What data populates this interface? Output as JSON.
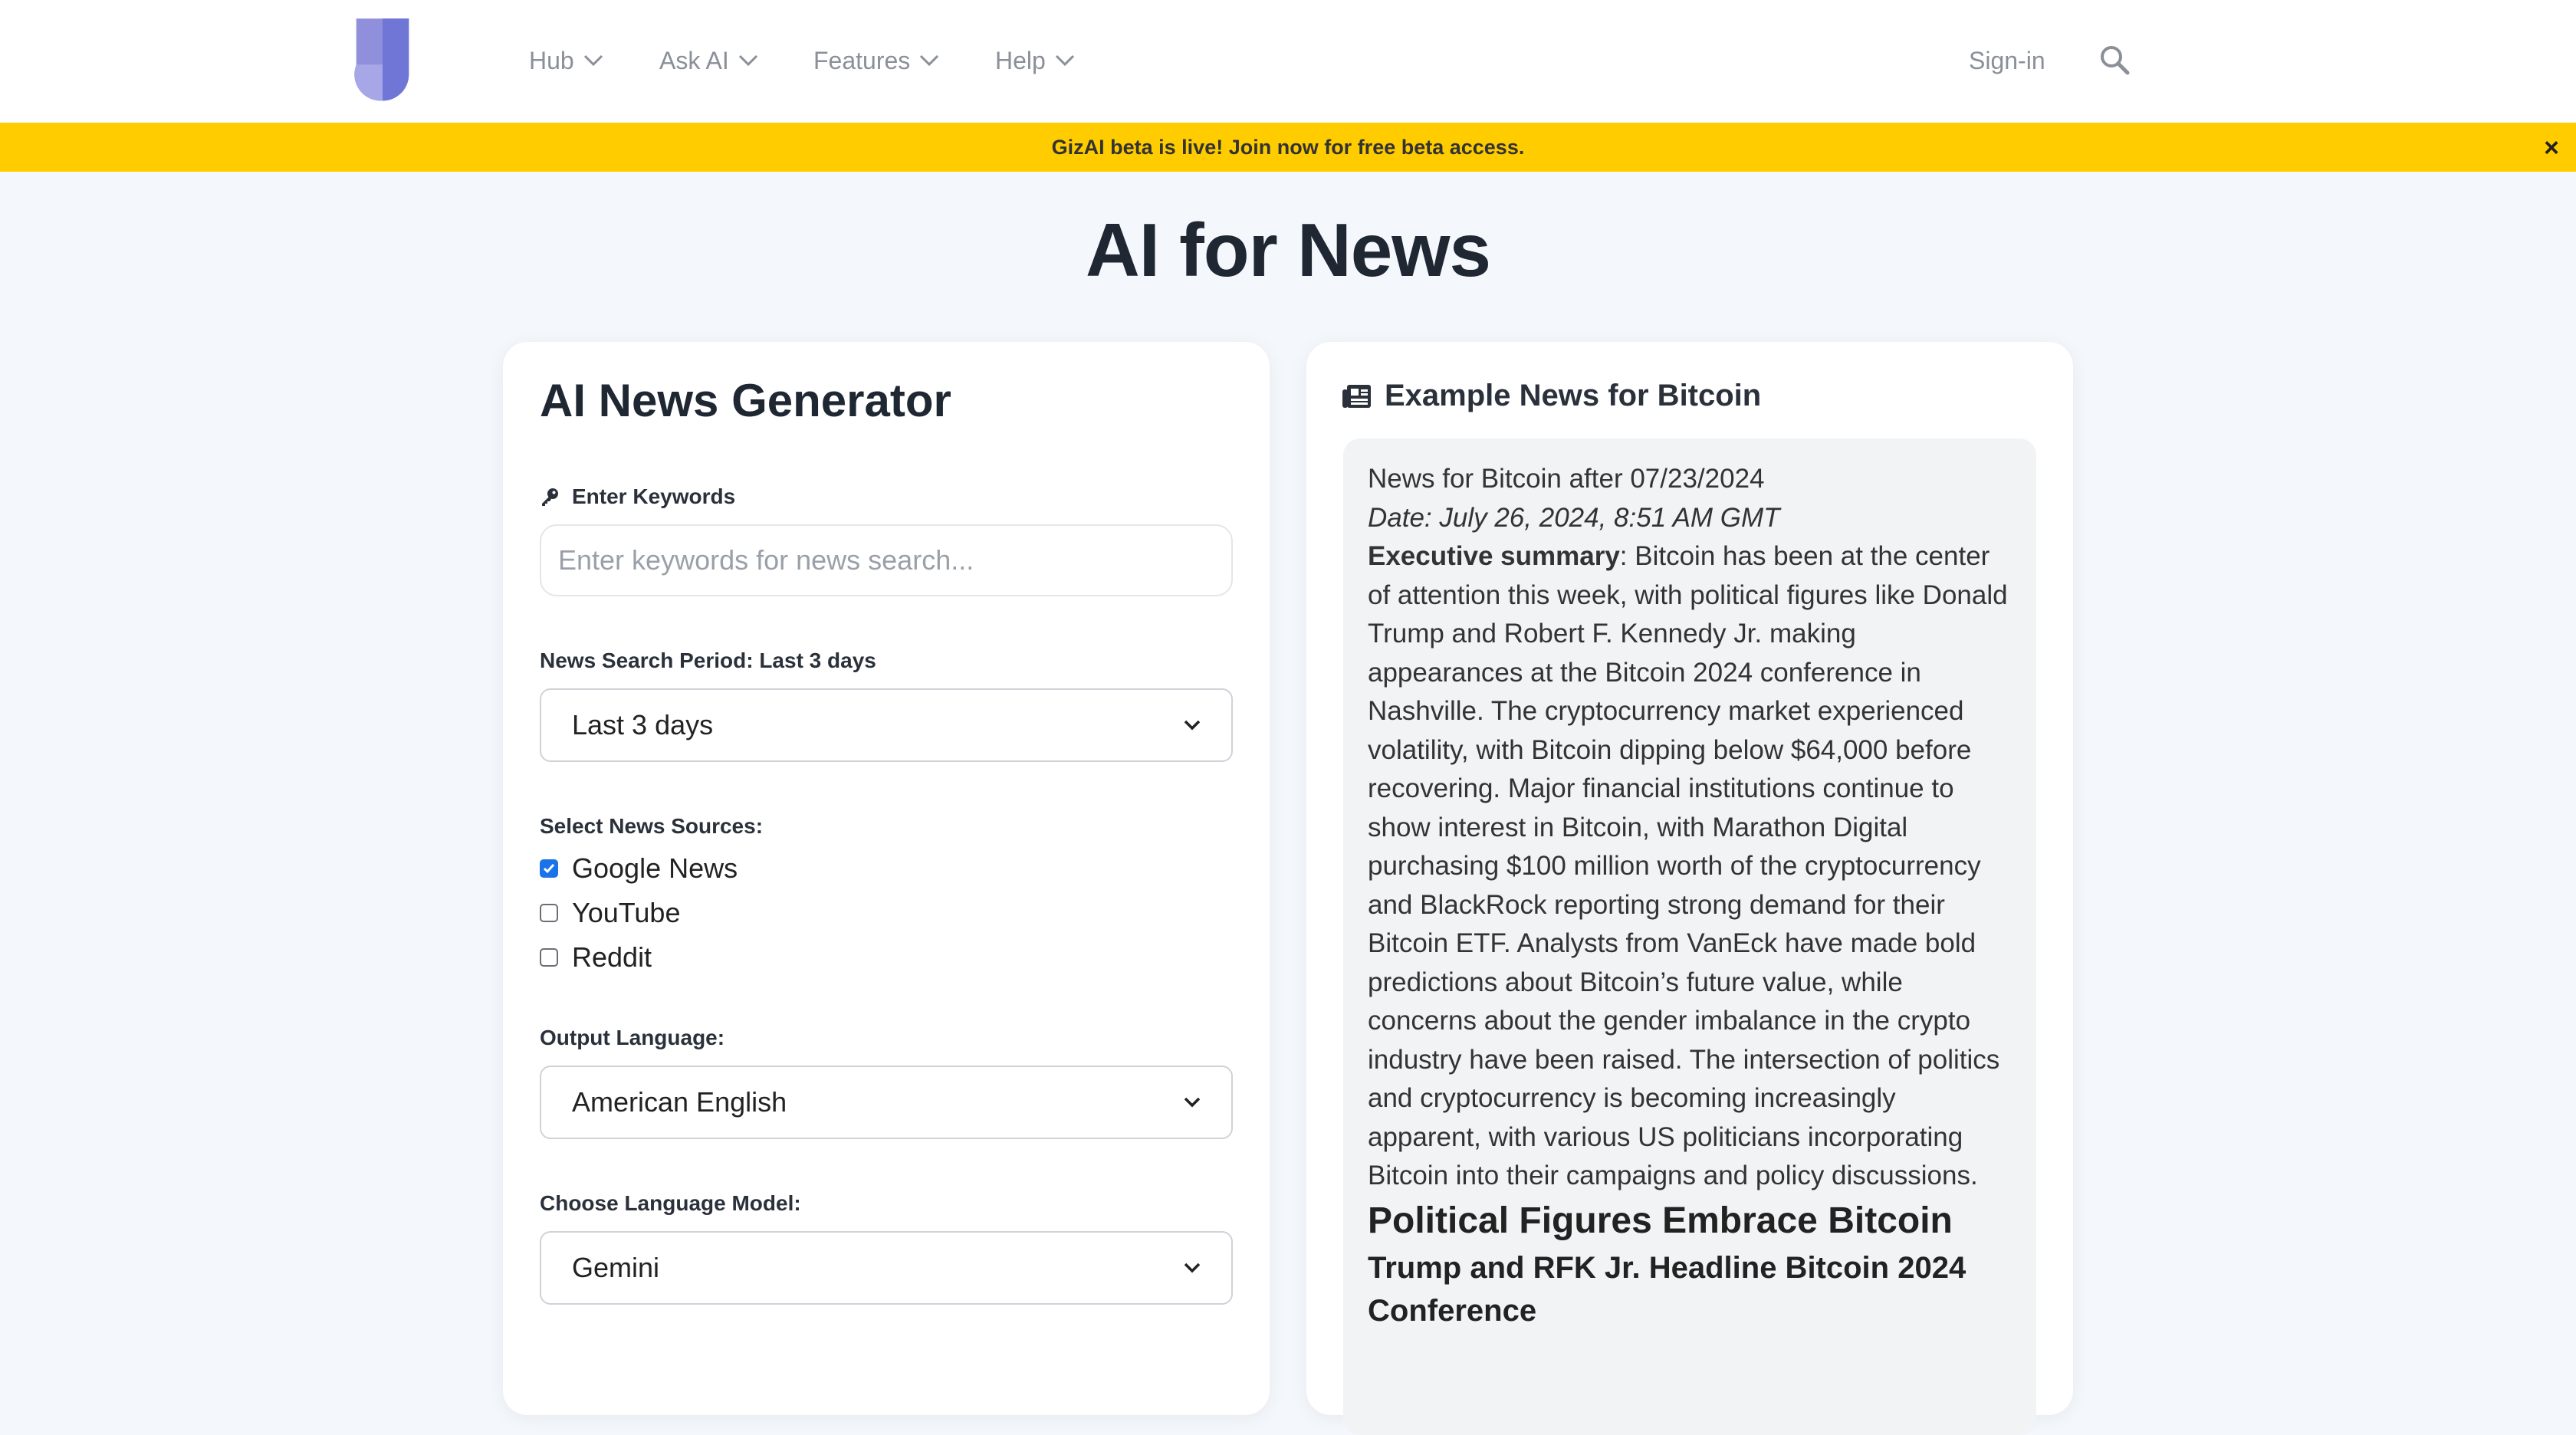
{
  "nav": {
    "items": [
      {
        "label": "Hub"
      },
      {
        "label": "Ask AI"
      },
      {
        "label": "Features"
      },
      {
        "label": "Help"
      }
    ],
    "signin_label": "Sign-in"
  },
  "banner": {
    "text": "GizAI beta is live! Join now for free beta access.",
    "close_label": "×"
  },
  "page": {
    "title": "AI for News"
  },
  "generator": {
    "title": "AI News Generator",
    "keywords_label": "Enter Keywords",
    "keywords_placeholder": "Enter keywords for news search...",
    "period_label": "News Search Period: Last 3 days",
    "period_value": "Last 3 days",
    "sources_label": "Select News Sources:",
    "sources": [
      {
        "label": "Google News",
        "checked": true
      },
      {
        "label": "YouTube",
        "checked": false
      },
      {
        "label": "Reddit",
        "checked": false
      }
    ],
    "language_label": "Output Language:",
    "language_value": "American English",
    "model_label": "Choose Language Model:",
    "model_value": "Gemini"
  },
  "example": {
    "title": "Example News for Bitcoin",
    "heading": "News for Bitcoin after 07/23/2024",
    "date": "Date: July 26, 2024, 8:51 AM GMT",
    "summary_label": "Executive summary",
    "summary_text": ": Bitcoin has been at the center of attention this week, with political figures like Donald Trump and Robert F. Kennedy Jr. making appearances at the Bitcoin 2024 conference in Nashville. The cryptocurrency market experienced volatility, with Bitcoin dipping below $64,000 before recovering. Major financial institutions continue to show interest in Bitcoin, with Marathon Digital purchasing $100 million worth of the cryptocurrency and BlackRock reporting strong demand for their Bitcoin ETF. Analysts from VanEck have made bold predictions about Bitcoin’s future value, while concerns about the gender imbalance in the crypto industry have been raised. The intersection of politics and cryptocurrency is becoming increasingly apparent, with various US politicians incorporating Bitcoin into their campaigns and policy discussions.",
    "section_title": "Political Figures Embrace Bitcoin",
    "subsection_title": "Trump and RFK Jr. Headline Bitcoin 2024 Conference"
  },
  "colors": {
    "banner": "#ffcc00",
    "page_bg": "#f4f7fb",
    "checkbox_on": "#1a73e8"
  }
}
